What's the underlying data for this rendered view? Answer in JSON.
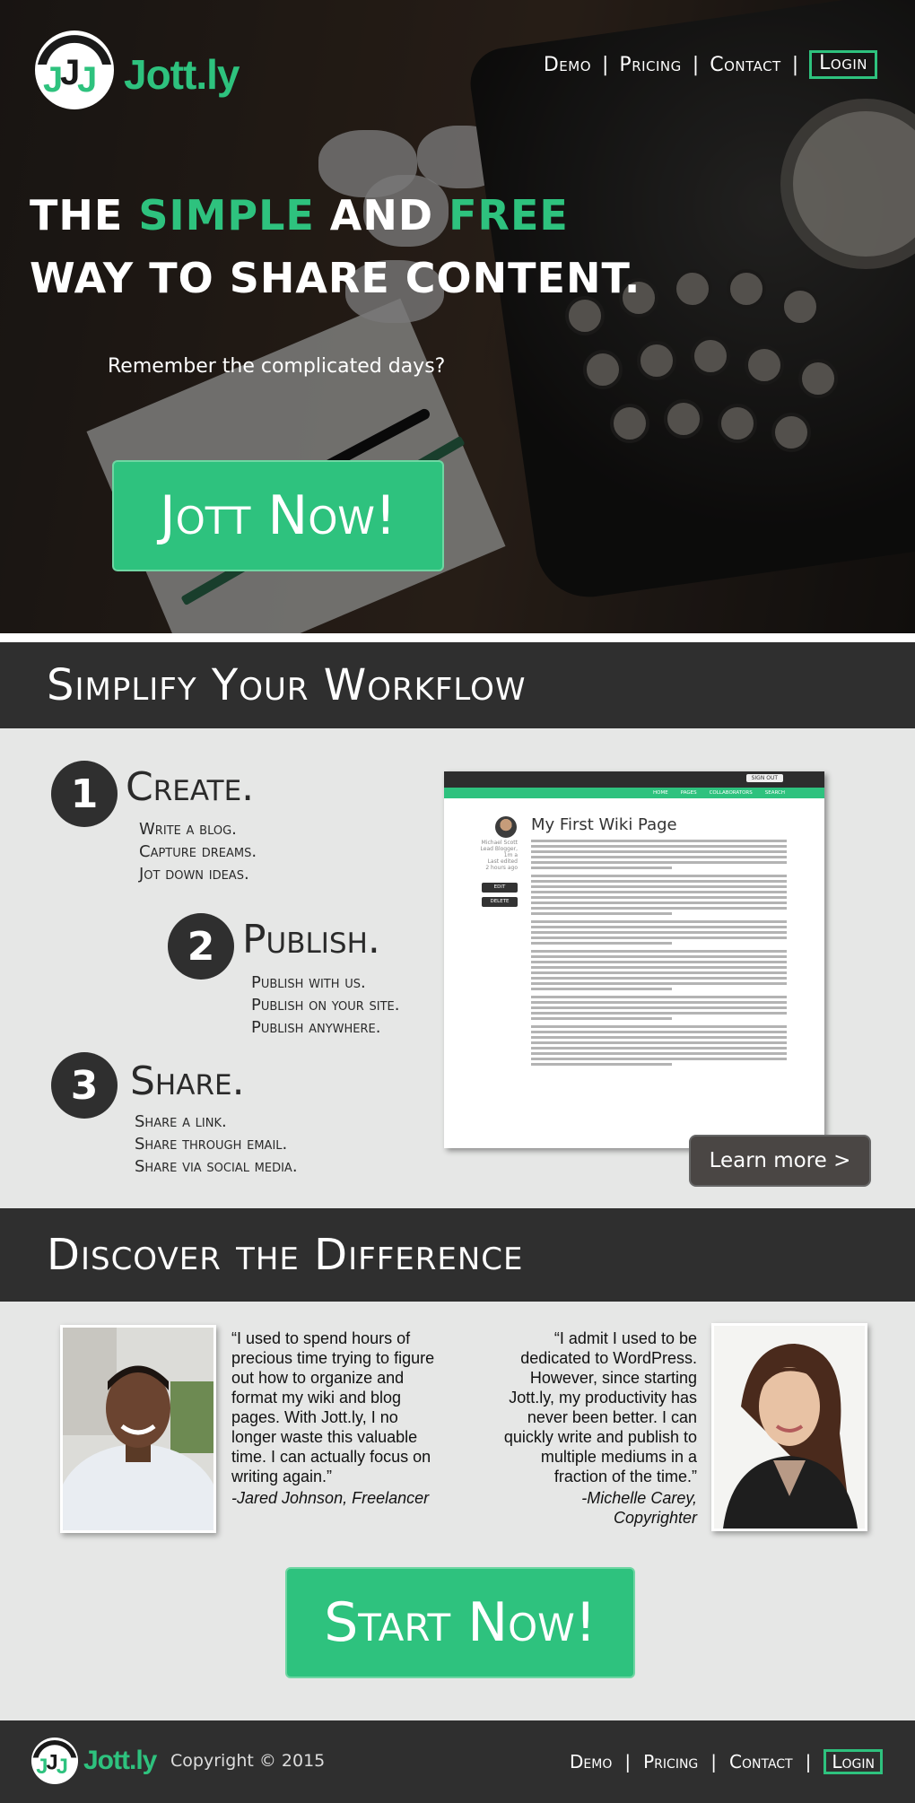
{
  "brand": {
    "name": "Jott.ly",
    "accent": "#2ec27e",
    "dark": "#2f2f2f"
  },
  "nav": {
    "demo": "Demo",
    "pricing": "Pricing",
    "contact": "Contact",
    "login": "Login",
    "separator": "|"
  },
  "hero": {
    "line1_a": "THE ",
    "line1_b": "SIMPLE",
    "line1_c": " AND ",
    "line1_d": "FREE",
    "line2": "WAY TO SHARE CONTENT.",
    "subtitle": "Remember the complicated days?",
    "cta": "Jott Now!"
  },
  "workflow": {
    "heading": "Simplify Your Workflow",
    "steps": [
      {
        "number": "1",
        "title": "Create.",
        "items": [
          "Write a blog.",
          "Capture dreams.",
          "Jot down ideas."
        ]
      },
      {
        "number": "2",
        "title": "Publish.",
        "items": [
          "Publish with us.",
          "Publish on your site.",
          "Publish anywhere."
        ]
      },
      {
        "number": "3",
        "title": "Share.",
        "items": [
          "Share a link.",
          "Share through email.",
          "Share via social media."
        ]
      }
    ],
    "wiki": {
      "sign_out": "SIGN OUT",
      "nav": [
        "HOME",
        "PAGES",
        "COLLABORATORS",
        "SEARCH"
      ],
      "title": "My First Wiki Page",
      "author": "Michael Scott",
      "author_meta": [
        "Lead Blogger,",
        "1m a",
        "Last edited",
        "2 hours ago"
      ],
      "edit": "EDIT",
      "delete": "DELETE"
    },
    "learn_more": "Learn more >"
  },
  "difference": {
    "heading": "Discover the Difference",
    "testimonials": [
      {
        "quote": "“I used to spend hours of precious time trying to figure out how to organize and format my wiki and blog pages. With Jott.ly, I no longer waste this valuable time. I can actually focus on writing again.”",
        "author": "-Jared Johnson, Freelancer"
      },
      {
        "quote": "“I admit I used to be dedicated to  WordPress. However, since starting Jott.ly, my productivity has never been better. I can quickly write and publish to multiple mediums in a fraction of the time.”",
        "author": "-Michelle Carey, Copyrighter"
      }
    ],
    "cta": "Start Now!"
  },
  "footer": {
    "brand": "Jott.ly",
    "copyright": "Copyright © 2015"
  }
}
